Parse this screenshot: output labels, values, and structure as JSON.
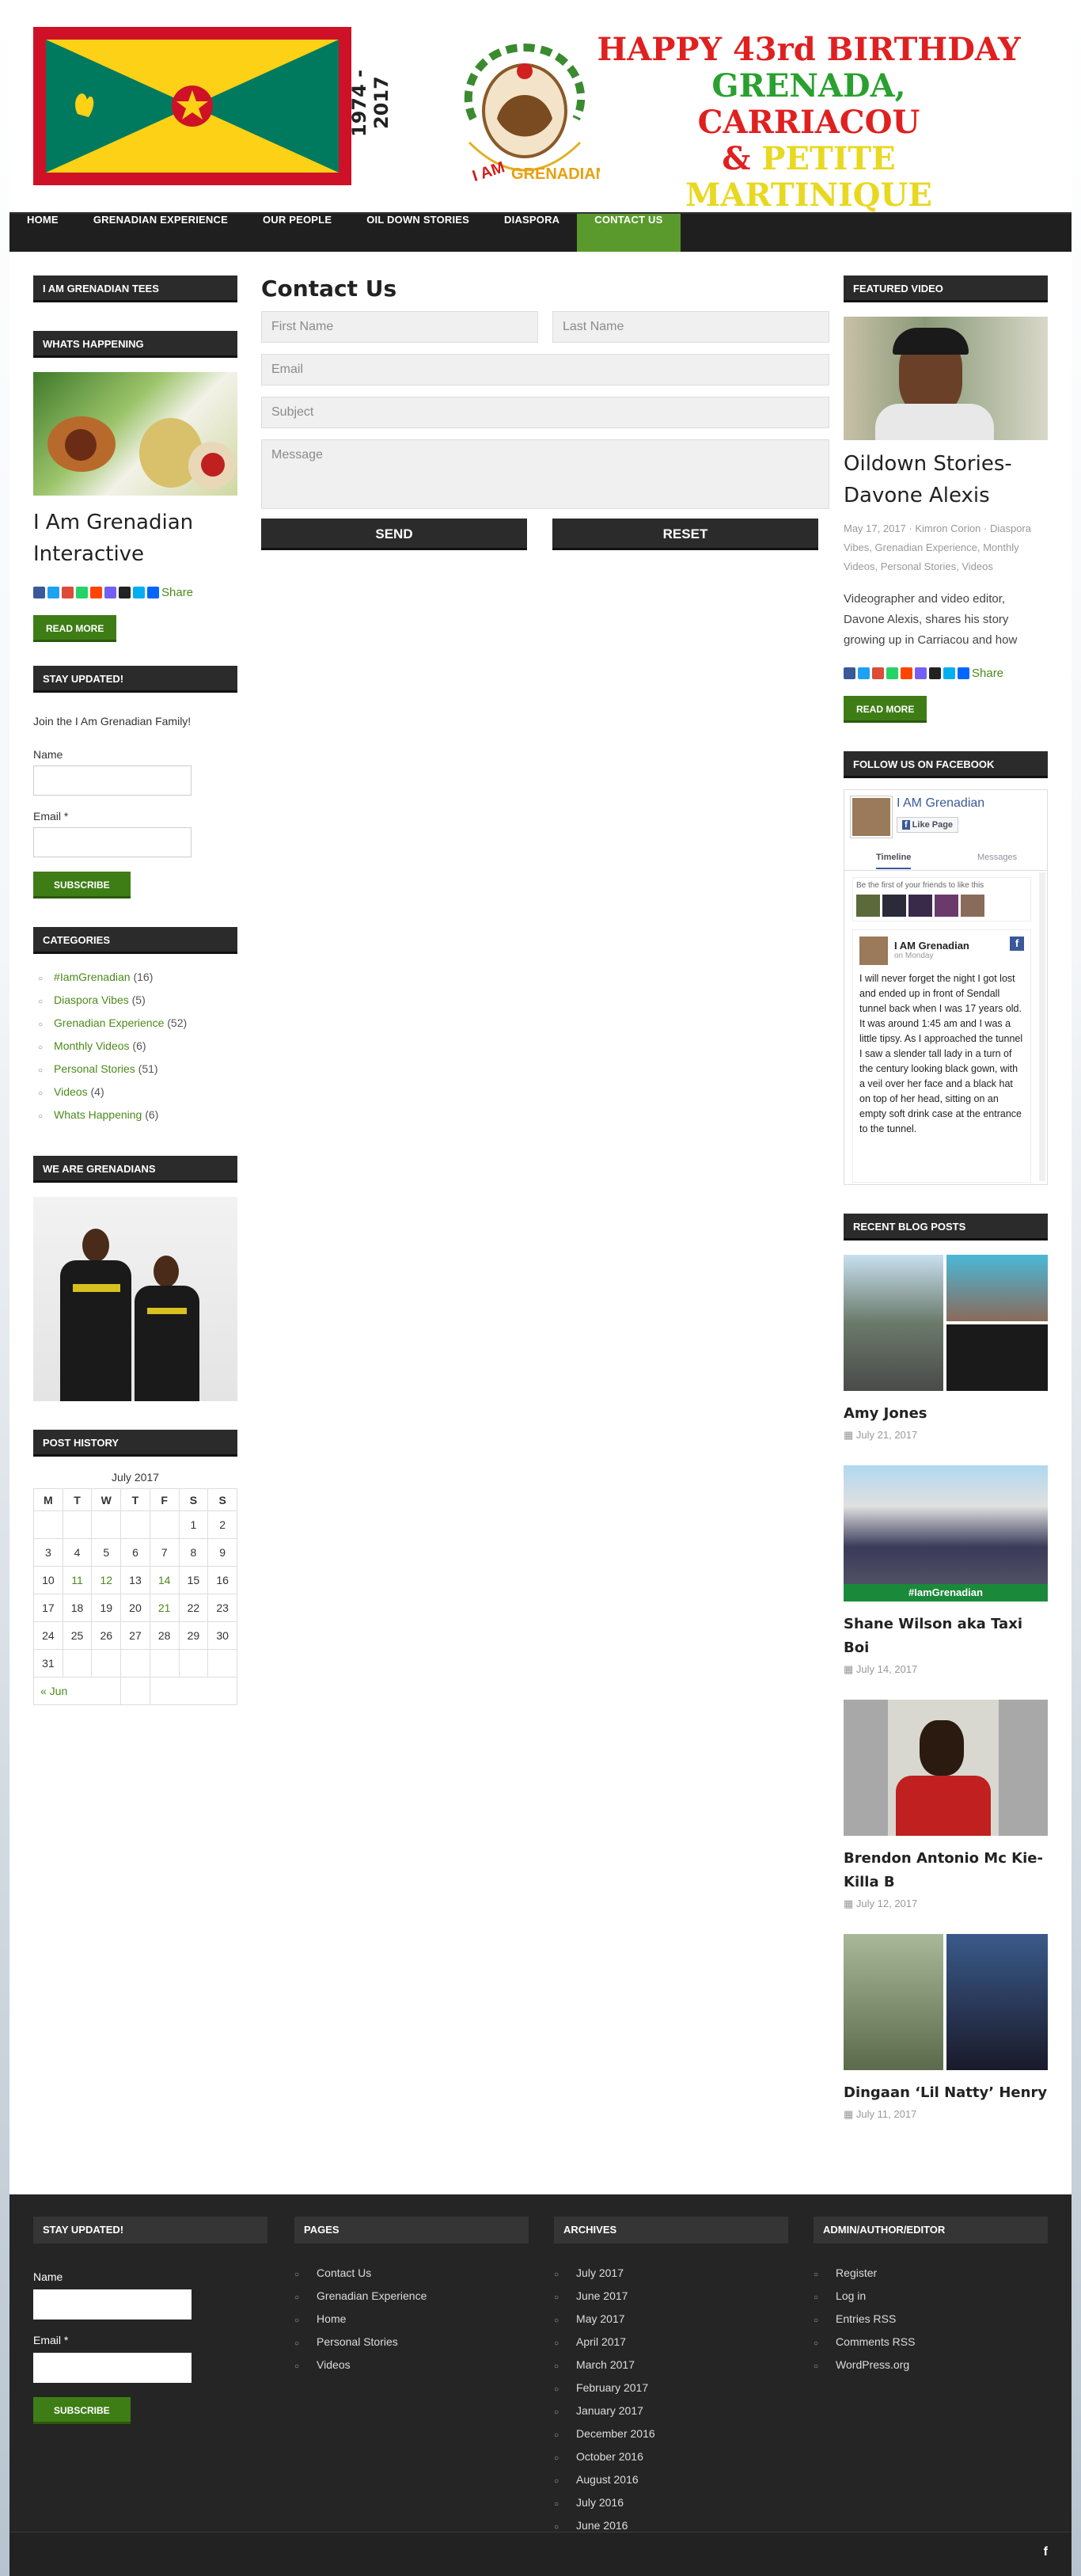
{
  "header": {
    "years": "1974 - 2017",
    "logo_text": "I AM GRENADIAN",
    "line1": "HAPPY 43rd  BIRTHDAY",
    "line2": "GRENADA,",
    "line3": "CARRIACOU",
    "line4_amp": "&",
    "line4": "PETITE MARTINIQUE"
  },
  "nav": {
    "items": [
      "HOME",
      "GRENADIAN EXPERIENCE",
      "OUR PEOPLE",
      "OIL DOWN STORIES",
      "DIASPORA",
      "CONTACT US"
    ],
    "active": "CONTACT US"
  },
  "left": {
    "tees_title": "I AM GRENADIAN TEES",
    "happening_title": "WHATS HAPPENING",
    "post_title": "I Am Grenadian Interactive",
    "share": "Share",
    "read_more": "READ MORE",
    "updated_title": "STAY UPDATED!",
    "join": "Join the I Am Grenadian Family!",
    "name_label": "Name",
    "email_label": "Email *",
    "subscribe": "SUBSCRIBE",
    "categories_title": "CATEGORIES",
    "categories": [
      {
        "name": "#IamGrenadian",
        "count": "(16)"
      },
      {
        "name": "Diaspora Vibes",
        "count": "(5)"
      },
      {
        "name": "Grenadian Experience",
        "count": "(52)"
      },
      {
        "name": "Monthly Videos",
        "count": "(6)"
      },
      {
        "name": "Personal Stories",
        "count": "(51)"
      },
      {
        "name": "Videos",
        "count": "(4)"
      },
      {
        "name": "Whats Happening",
        "count": "(6)"
      }
    ],
    "we_are_title": "WE ARE GRENADIANS",
    "history_title": "POST HISTORY",
    "calendar": {
      "caption": "July 2017",
      "days": [
        "M",
        "T",
        "W",
        "T",
        "F",
        "S",
        "S"
      ],
      "rows": [
        [
          "",
          "",
          "",
          "",
          "",
          "1",
          "2"
        ],
        [
          "3",
          "4",
          "5",
          "6",
          "7",
          "8",
          "9"
        ],
        [
          "10",
          "11",
          "12",
          "13",
          "14",
          "15",
          "16"
        ],
        [
          "17",
          "18",
          "19",
          "20",
          "21",
          "22",
          "23"
        ],
        [
          "24",
          "25",
          "26",
          "27",
          "28",
          "29",
          "30"
        ],
        [
          "31",
          "",
          "",
          "",
          "",
          "",
          ""
        ]
      ],
      "links": [
        "11",
        "12",
        "14",
        "21"
      ],
      "prev": "« Jun"
    }
  },
  "main": {
    "title": "Contact Us",
    "first_name": "First Name",
    "last_name": "Last Name",
    "email": "Email",
    "subject": "Subject",
    "message": "Message",
    "send": "SEND",
    "reset": "RESET"
  },
  "right": {
    "featured_title": "FEATURED VIDEO",
    "video_title": "Oildown Stories-Davone Alexis",
    "video_meta": "May 17, 2017   ·   Kimron Corion   ·   Diaspora Vibes, Grenadian Experience, Monthly Videos, Personal Stories, Videos",
    "video_excerpt": "Videographer and video editor, Davone Alexis, shares his story growing up in Carriacou and how",
    "share": "Share",
    "read_more": "READ MORE",
    "facebook_title": "FOLLOW US ON FACEBOOK",
    "fb": {
      "page": "I AM Grenadian",
      "like": "Like Page",
      "tab1": "Timeline",
      "tab2": "Messages",
      "friends": "Be the first of your friends to like this",
      "post_author": "I AM Grenadian",
      "post_time": "on Monday",
      "post_text": "I will never forget the night I got lost and ended up in front of Sendall tunnel back when I was 17 years old. It was around 1:45 am and I was a little tipsy. As I approached the tunnel I saw a slender tall lady in a turn of the century looking black gown, with a veil over her face and a black hat on top of her head, sitting on an empty soft drink case at the entrance to the tunnel."
    },
    "recent_title": "RECENT BLOG POSTS",
    "posts": [
      {
        "title": "Amy Jones",
        "date": "July 21, 2017"
      },
      {
        "title": "Shane Wilson aka Taxi Boi",
        "date": "July 14, 2017"
      },
      {
        "title": "Brendon Antonio Mc Kie- Killa B",
        "date": "July 12, 2017"
      },
      {
        "title": "Dingaan ‘Lil Natty’ Henry",
        "date": "July 11, 2017"
      }
    ],
    "banner_text": "#IamGrenadian"
  },
  "footer": {
    "updated_title": "STAY UPDATED!",
    "name_label": "Name",
    "email_label": "Email *",
    "subscribe": "SUBSCRIBE",
    "pages_title": "PAGES",
    "pages": [
      "Contact Us",
      "Grenadian Experience",
      "Home",
      "Personal Stories",
      "Videos"
    ],
    "archives_title": "ARCHIVES",
    "archives": [
      "July 2017",
      "June 2017",
      "May 2017",
      "April 2017",
      "March 2017",
      "February 2017",
      "January 2017",
      "December 2016",
      "October 2016",
      "August 2016",
      "July 2016",
      "June 2016"
    ],
    "admin_title": "ADMIN/AUTHOR/EDITOR",
    "admin": [
      "Register",
      "Log in",
      "Entries RSS",
      "Comments RSS",
      "WordPress.org"
    ],
    "fb_glyph": "f"
  },
  "colors": {
    "accent": "#4c8a1a",
    "dark": "#2b2b2b",
    "flag_red": "#ce1126",
    "flag_green": "#007a5e",
    "flag_yellow": "#fcd116"
  }
}
